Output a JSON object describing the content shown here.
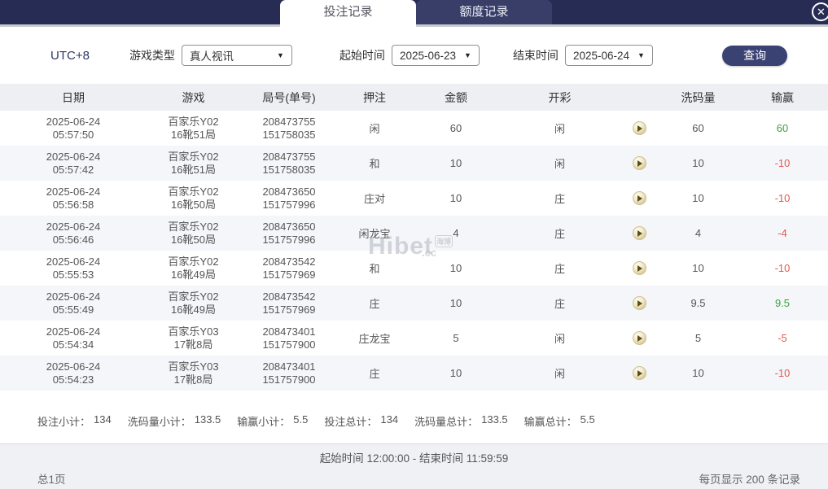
{
  "tabs": {
    "bet_records": "投注记录",
    "quota_records": "额度记录"
  },
  "icons": {
    "close": "✕",
    "dropdown_arrow": "▼"
  },
  "filters": {
    "timezone": "UTC+8",
    "game_type_label": "游戏类型",
    "game_type_value": "真人视讯",
    "start_time_label": "起始时间",
    "start_time_value": "2025-06-23",
    "end_time_label": "结束时间",
    "end_time_value": "2025-06-24",
    "query_button": "查询"
  },
  "table": {
    "headers": [
      "日期",
      "游戏",
      "局号(单号)",
      "押注",
      "金额",
      "开彩",
      "洗码量",
      "输赢"
    ],
    "rows": [
      {
        "date": "2025-06-24",
        "time": "05:57:50",
        "game": "百家乐Y02",
        "round": "16靴51局",
        "game_no": "208473755",
        "order_no": "151758035",
        "bet": "闲",
        "amount": "60",
        "result": "闲",
        "rolling": "60",
        "winloss": "60"
      },
      {
        "date": "2025-06-24",
        "time": "05:57:42",
        "game": "百家乐Y02",
        "round": "16靴51局",
        "game_no": "208473755",
        "order_no": "151758035",
        "bet": "和",
        "amount": "10",
        "result": "闲",
        "rolling": "10",
        "winloss": "-10"
      },
      {
        "date": "2025-06-24",
        "time": "05:56:58",
        "game": "百家乐Y02",
        "round": "16靴50局",
        "game_no": "208473650",
        "order_no": "151757996",
        "bet": "庄对",
        "amount": "10",
        "result": "庄",
        "rolling": "10",
        "winloss": "-10"
      },
      {
        "date": "2025-06-24",
        "time": "05:56:46",
        "game": "百家乐Y02",
        "round": "16靴50局",
        "game_no": "208473650",
        "order_no": "151757996",
        "bet": "闲龙宝",
        "amount": "4",
        "result": "庄",
        "rolling": "4",
        "winloss": "-4"
      },
      {
        "date": "2025-06-24",
        "time": "05:55:53",
        "game": "百家乐Y02",
        "round": "16靴49局",
        "game_no": "208473542",
        "order_no": "151757969",
        "bet": "和",
        "amount": "10",
        "result": "庄",
        "rolling": "10",
        "winloss": "-10"
      },
      {
        "date": "2025-06-24",
        "time": "05:55:49",
        "game": "百家乐Y02",
        "round": "16靴49局",
        "game_no": "208473542",
        "order_no": "151757969",
        "bet": "庄",
        "amount": "10",
        "result": "庄",
        "rolling": "9.5",
        "winloss": "9.5"
      },
      {
        "date": "2025-06-24",
        "time": "05:54:34",
        "game": "百家乐Y03",
        "round": "17靴8局",
        "game_no": "208473401",
        "order_no": "151757900",
        "bet": "庄龙宝",
        "amount": "5",
        "result": "闲",
        "rolling": "5",
        "winloss": "-5"
      },
      {
        "date": "2025-06-24",
        "time": "05:54:23",
        "game": "百家乐Y03",
        "round": "17靴8局",
        "game_no": "208473401",
        "order_no": "151757900",
        "bet": "庄",
        "amount": "10",
        "result": "闲",
        "rolling": "10",
        "winloss": "-10"
      }
    ]
  },
  "summary": [
    {
      "label": "投注小计：",
      "value": "134"
    },
    {
      "label": "洗码量小计：",
      "value": "133.5"
    },
    {
      "label": "输赢小计：",
      "value": "5.5"
    },
    {
      "label": "投注总计：",
      "value": "134"
    },
    {
      "label": "洗码量总计：",
      "value": "133.5"
    },
    {
      "label": "输赢总计：",
      "value": "5.5"
    }
  ],
  "footer": {
    "time_range": "起始时间 12:00:00 - 结束时间 11:59:59",
    "page_info": "总1页",
    "per_page_info": "每页显示 200 条记录"
  },
  "watermark": {
    "text": "Hibet",
    "suffix": ".cc",
    "stamp": "海博"
  },
  "colors": {
    "win": "#3aa53c",
    "loss": "#e25a52",
    "accent": "#272c55"
  }
}
